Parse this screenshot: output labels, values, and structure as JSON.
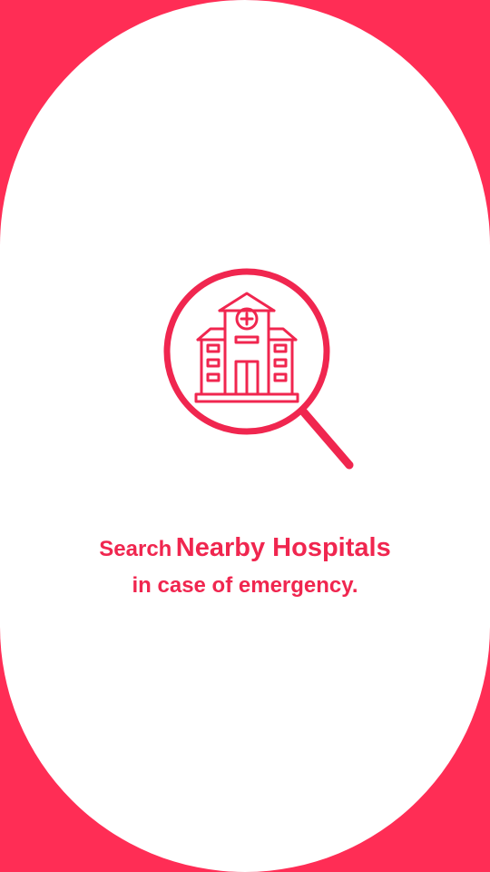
{
  "onboarding": {
    "headline_lead": "Search",
    "headline_emphasis": "Nearby Hospitals",
    "subline": "in case of emergency.",
    "illustration_icon": "hospital-search-icon"
  },
  "colors": {
    "accent": "#ff2d55",
    "text": "#f0264f",
    "background": "#ffffff"
  }
}
